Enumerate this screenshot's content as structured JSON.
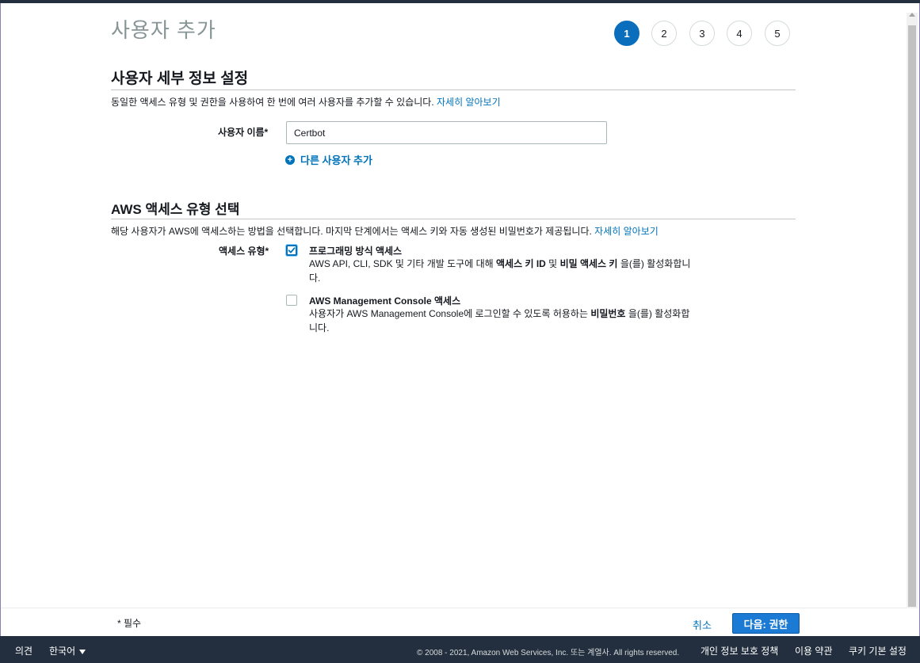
{
  "page": {
    "title": "사용자 추가"
  },
  "steps": [
    "1",
    "2",
    "3",
    "4",
    "5"
  ],
  "user_details": {
    "heading": "사용자 세부 정보 설정",
    "description": "동일한 액세스 유형 및 권한을 사용하여 한 번에 여러 사용자를 추가할 수 있습니다.",
    "learn_more": "자세히 알아보기",
    "username_label": "사용자 이름*",
    "username_value": "Certbot",
    "add_another_user": "다른 사용자 추가"
  },
  "access_type": {
    "heading": "AWS 액세스 유형 선택",
    "description": "해당 사용자가 AWS에 액세스하는 방법을 선택합니다. 마지막 단계에서는 액세스 키와 자동 생성된 비밀번호가 제공됩니다.",
    "learn_more": "자세히 알아보기",
    "label": "액세스 유형*",
    "options": [
      {
        "title": "프로그래밍 방식 액세스",
        "checked": true,
        "desc_1": "AWS API, CLI, SDK 및 기타 개발 도구에 대해 ",
        "desc_bold_1": "액세스 키 ID",
        "desc_2": " 및 ",
        "desc_bold_2": "비밀 액세스 키",
        "desc_3": " 을(를) 활성화합니다."
      },
      {
        "title": "AWS Management Console 액세스",
        "checked": false,
        "desc_1": "사용자가 AWS Management Console에 로그인할 수 있도록 허용하는 ",
        "desc_bold_1": "비밀번호",
        "desc_2": " 을(를) 활성화합니다."
      }
    ]
  },
  "footer_actions": {
    "required_note": "* 필수",
    "cancel": "취소",
    "next": "다음: 권한"
  },
  "console_footer": {
    "feedback": "의견",
    "language": "한국어",
    "copyright": "© 2008 - 2021, Amazon Web Services, Inc. 또는 계열사. All rights reserved.",
    "privacy": "개인 정보 보호 정책",
    "terms": "이용 약관",
    "cookies": "쿠키 기본 설정"
  },
  "colors": {
    "accent": "#0073bb",
    "active_step": "#0a6ebd",
    "primary_button": "#1a7ad4",
    "console_footer_bg": "#232f3e"
  }
}
